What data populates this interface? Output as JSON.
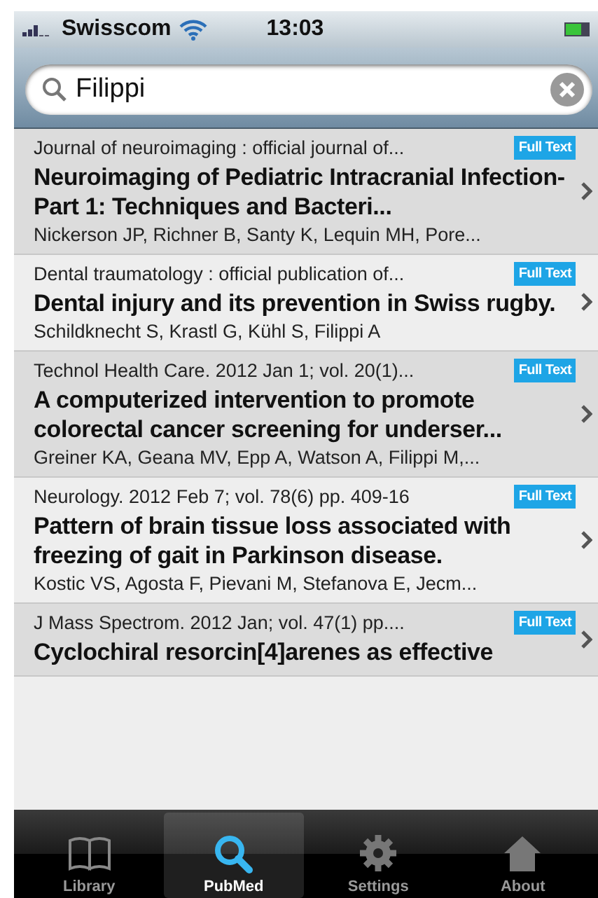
{
  "status_bar": {
    "carrier": "Swisscom",
    "time": "13:03"
  },
  "search": {
    "value": "Filippi"
  },
  "articles": [
    {
      "journal": "Journal of neuroimaging : official journal of...",
      "badge": "Full Text",
      "title": "Neuroimaging of Pediatric Intracranial Infection-Part 1: Techniques and Bacteri...",
      "authors": "Nickerson JP, Richner B, Santy K, Lequin MH, Pore..."
    },
    {
      "journal": "Dental traumatology : official publication of...",
      "badge": "Full Text",
      "title": "Dental injury and its prevention in Swiss rugby.",
      "authors": "Schildknecht S, Krastl G, Kühl S, Filippi A"
    },
    {
      "journal": "Technol Health Care. 2012 Jan 1; vol. 20(1)...",
      "badge": "Full Text",
      "title": "A computerized intervention to promote colorectal cancer screening for underser...",
      "authors": "Greiner KA, Geana MV, Epp A, Watson A, Filippi M,..."
    },
    {
      "journal": "Neurology. 2012 Feb 7; vol. 78(6) pp. 409-16",
      "badge": "Full Text",
      "title": "Pattern of brain tissue loss associated with freezing of gait in Parkinson disease.",
      "authors": "Kostic VS, Agosta F, Pievani M, Stefanova E, Jecm..."
    },
    {
      "journal": "J Mass Spectrom. 2012 Jan; vol. 47(1) pp....",
      "badge": "Full Text",
      "title": "Cyclochiral resorcin[4]arenes as effective"
    }
  ],
  "tabs": [
    {
      "kind": "book",
      "label": "Library",
      "selected": false
    },
    {
      "kind": "search",
      "label": "PubMed",
      "selected": true
    },
    {
      "kind": "gear",
      "label": "Settings",
      "selected": false
    },
    {
      "kind": "house",
      "label": "About",
      "selected": false
    }
  ]
}
